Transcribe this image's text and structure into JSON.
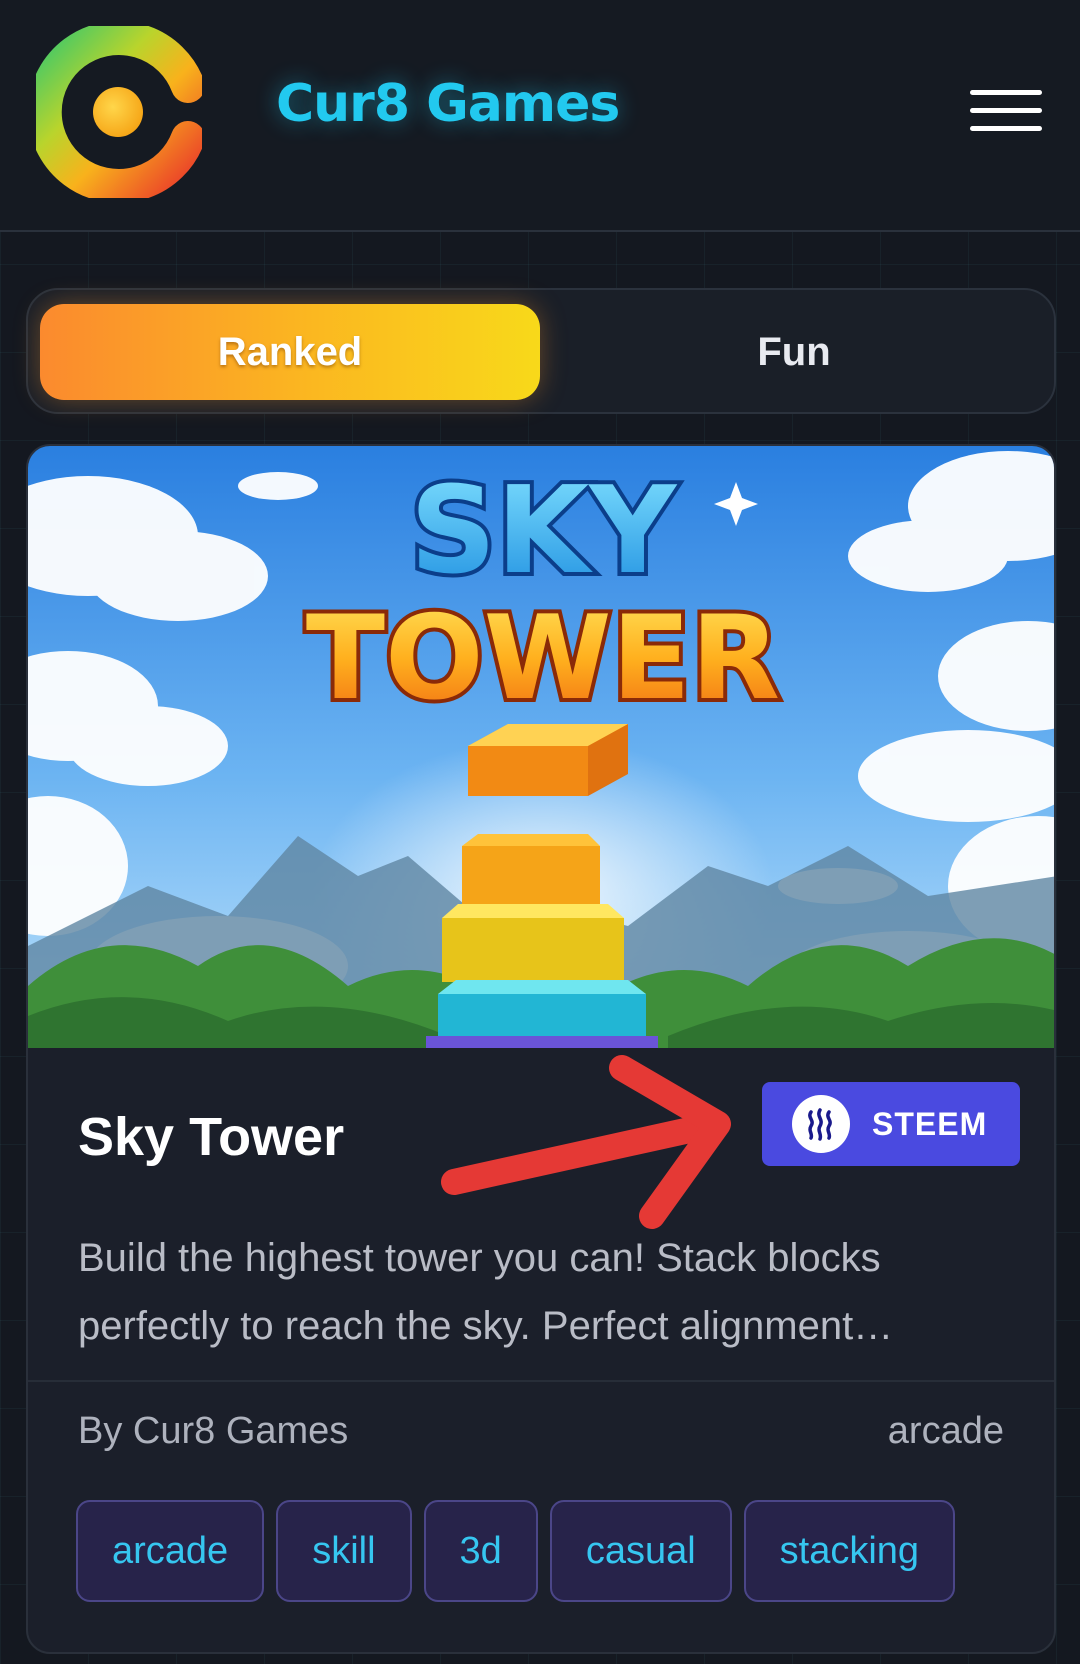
{
  "header": {
    "brand": "Cur8 Games",
    "logo_icon": "cur8-logo-icon",
    "menu_icon": "hamburger-menu-icon"
  },
  "mode_switch": {
    "tabs": [
      {
        "label": "Ranked",
        "active": true
      },
      {
        "label": "Fun",
        "active": false
      }
    ]
  },
  "game": {
    "banner_title_line1": "SKY",
    "banner_title_line2": "TOWER",
    "title": "Sky Tower",
    "token_label": "STEEM",
    "token_icon": "steem-logo-icon",
    "description": "Build the highest tower you can! Stack blocks perfectly to reach the sky. Perfect alignment…",
    "author": "By Cur8 Games",
    "category": "arcade",
    "tags": [
      "arcade",
      "skill",
      "3d",
      "casual",
      "stacking"
    ]
  },
  "colors": {
    "brand_accent": "#22c9ef",
    "ranked_gradient_start": "#fb8a2e",
    "ranked_gradient_end": "#f8d91a",
    "steem_badge": "#4a4ae0",
    "tag_text": "#36c6f0",
    "annotation_arrow": "#e53935"
  }
}
